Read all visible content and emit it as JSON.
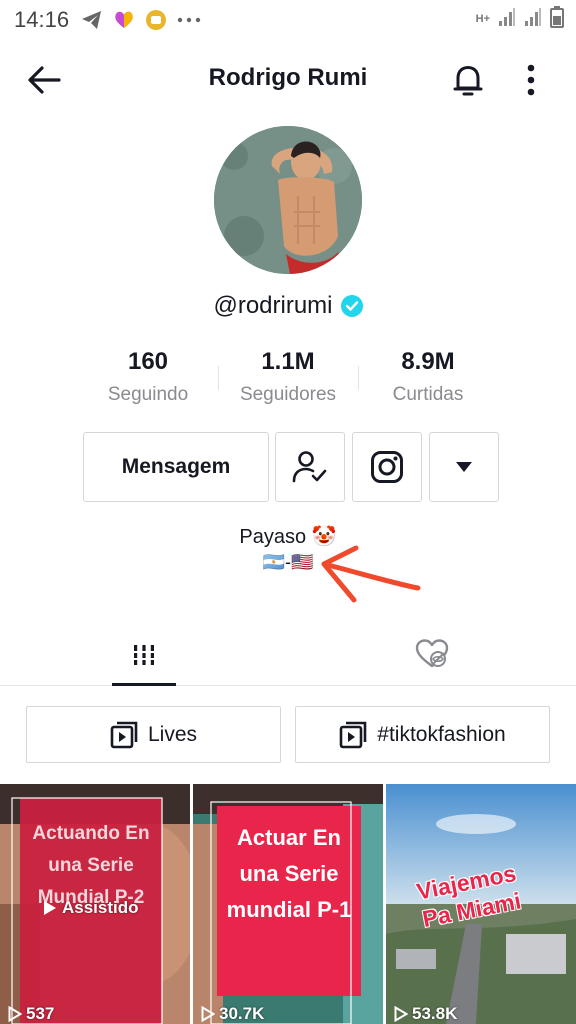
{
  "status_bar": {
    "time": "14:16",
    "icons": [
      "telegram-icon",
      "likee-icon",
      "coin-icon",
      "more-dots-icon"
    ],
    "right_icons": [
      "hplus-icon",
      "signal-icon",
      "signal-icon",
      "battery-icon"
    ],
    "network_label": "H+"
  },
  "header": {
    "title": "Rodrigo Rumi",
    "back_icon": "arrow-left-icon",
    "bell_icon": "bell-icon",
    "more_icon": "vertical-dots-icon"
  },
  "profile": {
    "username": "@rodrirumi",
    "verified": true,
    "stats": [
      {
        "value": "160",
        "label": "Seguindo"
      },
      {
        "value": "1.1M",
        "label": "Seguidores"
      },
      {
        "value": "8.9M",
        "label": "Curtidas"
      }
    ],
    "message_label": "Mensagem",
    "bio_line1": "Payaso 🤡",
    "bio_line2": "🇦🇷-🇺🇸"
  },
  "tabs": [
    {
      "name": "videos",
      "icon": "grid-icon",
      "active": true
    },
    {
      "name": "liked",
      "icon": "hidden-heart-icon",
      "active": false
    }
  ],
  "playlists": [
    {
      "label": "Lives",
      "icon": "playlist-icon"
    },
    {
      "label": "#tiktokfashion",
      "icon": "playlist-icon"
    }
  ],
  "videos": [
    {
      "caption": "Actuando En una Serie Mundial P-2",
      "views": "537",
      "watched_label": "Assistido"
    },
    {
      "caption": "Actuar En una Serie mundial P-1",
      "views": "30.7K"
    },
    {
      "caption": "Viajemos Pa Miami",
      "views": "53.8K"
    }
  ],
  "colors": {
    "accent_red": "#e8254b",
    "verified_blue": "#20d5ec",
    "annotation_arrow": "#f04a2c"
  }
}
